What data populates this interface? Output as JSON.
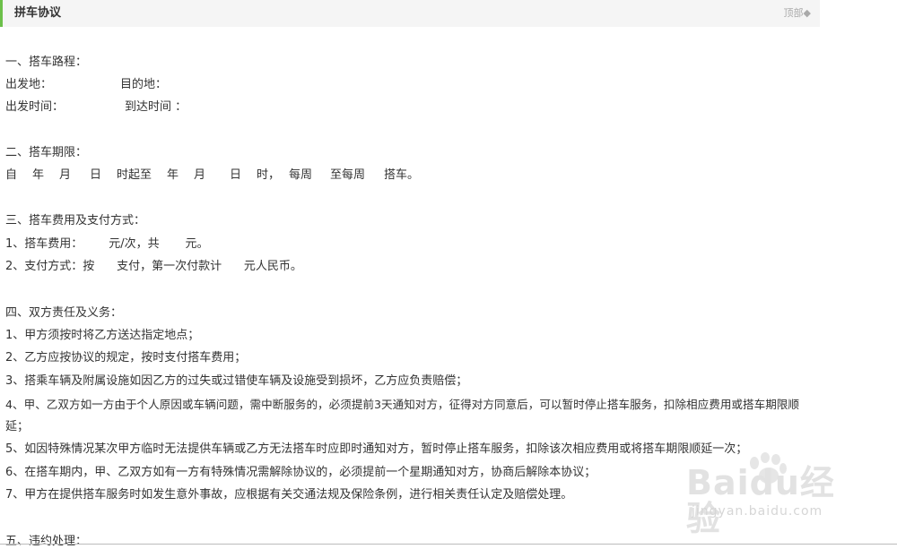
{
  "header": {
    "title": "拼车协议",
    "top_link": "顶部◆"
  },
  "sections": {
    "route_title": "一、搭车路程：",
    "departure_label": "出发地：",
    "destination_label": "目的地：",
    "depart_time_label": "出发时间：",
    "arrive_time_label": "到达时间 ：",
    "period_title": "二、搭车期限：",
    "period_parts": [
      "自",
      "年",
      "月",
      "日",
      "时起至",
      "年",
      "月",
      "日",
      "时，",
      "每周",
      "至每周",
      "搭车。"
    ],
    "fee_title": "三、搭车费用及支付方式：",
    "fee_item_1": "1、搭车费用：       元/次，共       元。",
    "fee_item_2": "2、支付方式：按      支付，第一次付款计      元人民币。",
    "duty_title": "四、双方责任及义务：",
    "duty_items": [
      "1、甲方须按时将乙方送达指定地点；",
      "2、乙方应按协议的规定，按时支付搭车费用；",
      "3、搭乘车辆及附属设施如因乙方的过失或过错使车辆及设施受到损坏，乙方应负责赔偿；",
      "4、甲、乙双方如一方由于个人原因或车辆问题，需中断服务的，必须提前3天通知对方，征得对方同意后，可以暂时停止搭车服务，扣除相应费用或搭车期限顺",
      "延；",
      "5、如因特殊情况某次甲方临时无法提供车辆或乙方无法搭车时应即时通知对方，暂时停止搭车服务，扣除该次相应费用或将搭车期限顺延一次；",
      "6、在搭车期内，甲、乙双方如有一方有特殊情况需解除协议的，必须提前一个星期通知对方，协商后解除本协议；",
      "7、甲方在提供搭车服务时如发生意外事故，应根据有关交通法规及保险条例，进行相关责任认定及赔偿处理。"
    ],
    "breach_title": "五、违约处理："
  },
  "watermark": {
    "brand": "Baidu经验",
    "url": "jingyan.baidu.com"
  },
  "colors": {
    "accent": "#6cc04a",
    "header_bg": "#f5f5f5",
    "text": "#333333",
    "muted": "#aaaaaa"
  }
}
